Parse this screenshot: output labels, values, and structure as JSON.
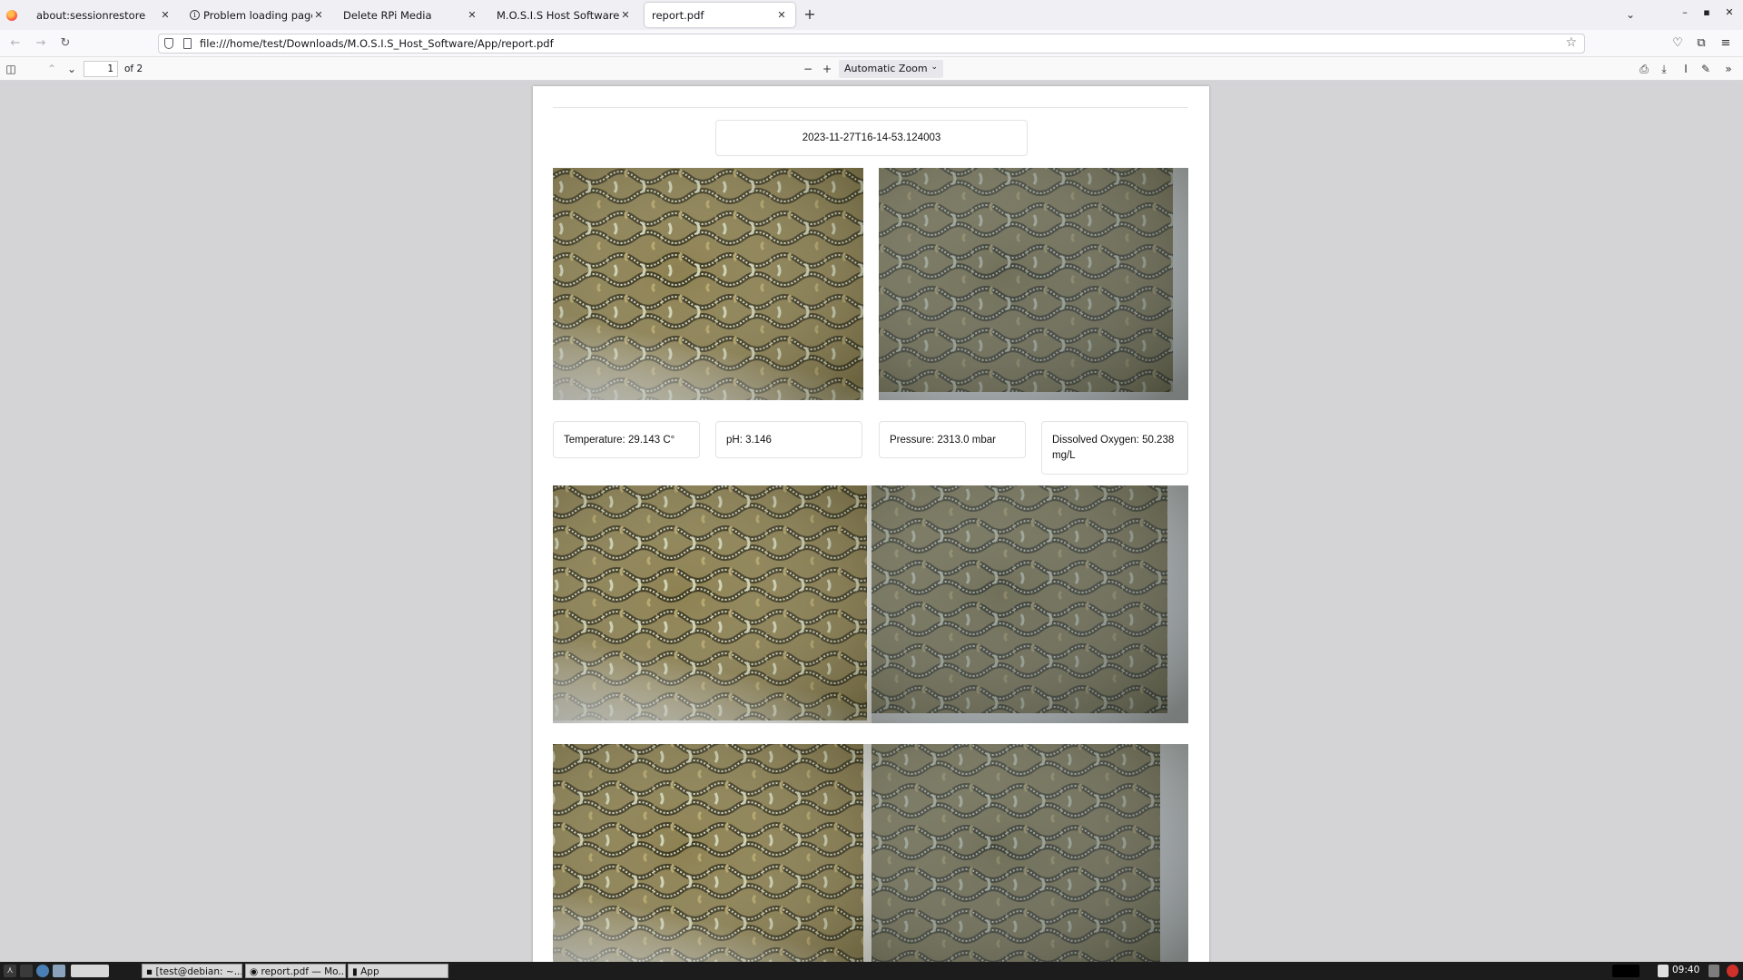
{
  "browser": {
    "tabs": [
      {
        "label": "about:sessionrestore",
        "active": false
      },
      {
        "label": "Problem loading page",
        "active": false
      },
      {
        "label": "Delete RPi Media",
        "active": false
      },
      {
        "label": "M.O.S.I.S Host Software Hon",
        "active": false
      },
      {
        "label": "report.pdf",
        "active": true
      }
    ],
    "url": "file:///home/test/Downloads/M.O.S.I.S_Host_Software/App/report.pdf"
  },
  "pdf_toolbar": {
    "page_number": "1",
    "page_count": "of 2",
    "zoom": "Automatic Zoom"
  },
  "report": {
    "timestamp": "2023-11-27T16-14-53.124003",
    "readings": {
      "temperature": "Temperature: 29.143 C°",
      "ph": "pH: 3.146",
      "pressure": "Pressure: 2313.0 mbar",
      "oxygen": "Dissolved Oxygen: 50.238 mg/L"
    }
  },
  "taskbar": {
    "tasks": [
      "[test@debian: ~...",
      "report.pdf — Mo...",
      "App"
    ],
    "clock": "09:40"
  },
  "colors": {
    "coral_base": "#8a7e50",
    "coral_ridge": "#d8dcc0",
    "coral_groove": "#3e3a22"
  }
}
